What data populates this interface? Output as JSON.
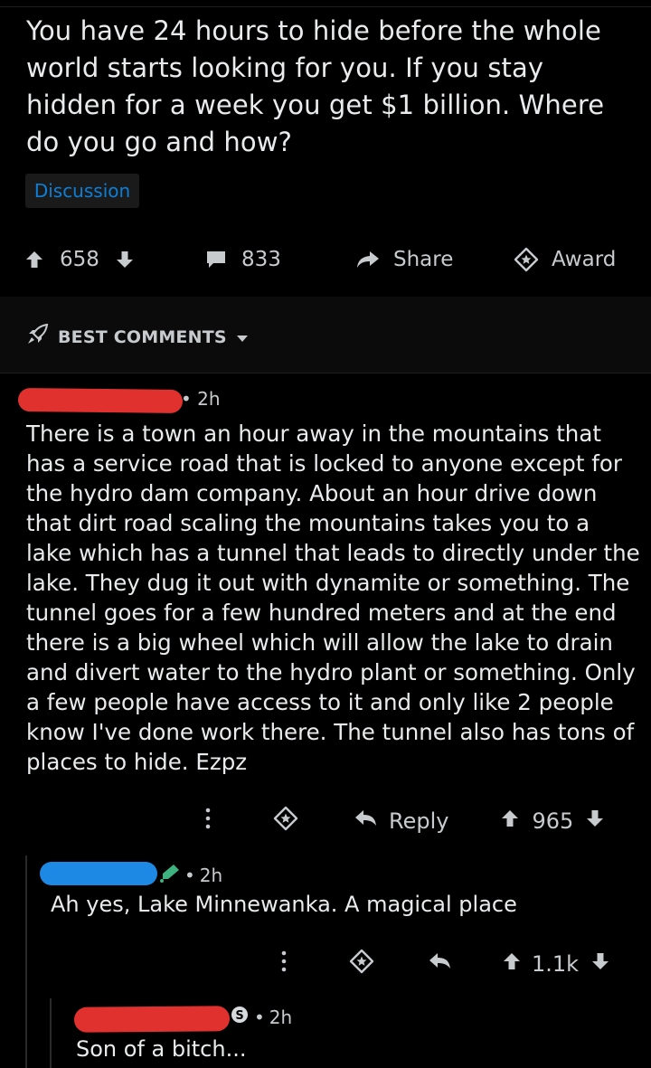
{
  "post": {
    "title": "You have 24 hours to hide before the whole world starts looking for you. If you stay hidden for a week you get $1 billion. Where do you go and how?",
    "flair": "Discussion",
    "upvotes": "658",
    "comments": "833",
    "share_label": "Share",
    "award_label": "Award"
  },
  "sort": {
    "label": "BEST COMMENTS"
  },
  "comments": [
    {
      "time": "2h",
      "body": "There is a town an hour away in the mountains that has a service road that is locked to anyone except for the hydro dam company. About an hour drive down that dirt road scaling the mountains takes you to a lake which has a tunnel that leads to directly under the lake. They dug it out with dynamite or something. The tunnel goes for a few hundred meters and at the end there is a big wheel which will allow the lake to drain and divert water to the hydro plant or something. Only a few people have access to it and only like 2 people know I've done work there. The tunnel also has tons of places to hide. Ezpz",
      "reply_label": "Reply",
      "score": "965"
    },
    {
      "time": "2h",
      "body": "Ah yes, Lake Minnewanka. A magical place",
      "score": "1.1k"
    },
    {
      "time": "2h",
      "body": "Son of a bitch..."
    }
  ],
  "colors": {
    "background": "#000000",
    "flair_text": "#0f7fd6",
    "redact_red": "#e0312f",
    "redact_blue": "#1e88e5",
    "mod_icon_green": "#3fb37f"
  }
}
